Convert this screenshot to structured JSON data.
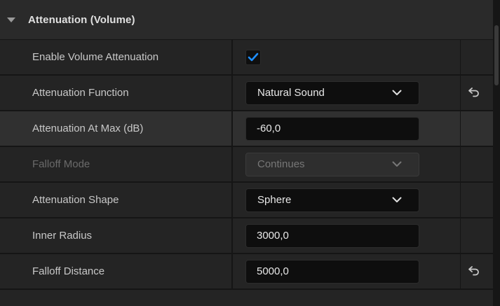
{
  "section": {
    "title": "Attenuation (Volume)"
  },
  "rows": [
    {
      "label": "Enable Volume Attenuation",
      "type": "checkbox",
      "checked": true
    },
    {
      "label": "Attenuation Function",
      "type": "dropdown",
      "value": "Natural Sound",
      "reset": true
    },
    {
      "label": "Attenuation At Max (dB)",
      "type": "number",
      "value": "-60,0"
    },
    {
      "label": "Falloff Mode",
      "type": "dropdown",
      "value": "Continues",
      "disabled": true
    },
    {
      "label": "Attenuation Shape",
      "type": "dropdown",
      "value": "Sphere"
    },
    {
      "label": "Inner Radius",
      "type": "number",
      "value": "3000,0"
    },
    {
      "label": "Falloff Distance",
      "type": "number",
      "value": "5000,0",
      "reset": true
    }
  ],
  "colors": {
    "accent": "#1e8fff",
    "panel": "#242424",
    "header": "#2a2a2a"
  }
}
